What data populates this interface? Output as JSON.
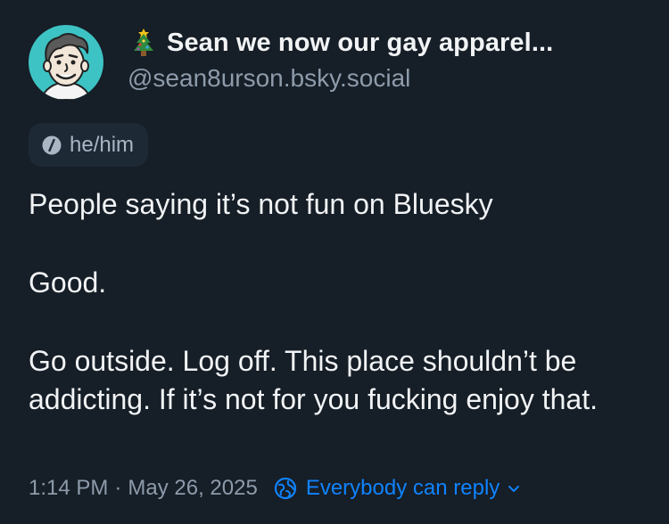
{
  "author": {
    "emoji_icon": "christmas-tree-icon",
    "display_name": "Sean we now our gay apparel...",
    "handle": "@sean8urson.bsky.social",
    "avatar": "cartoon-face-avatar"
  },
  "pronouns": "he/him",
  "post": {
    "paragraphs": [
      "People saying it’s not fun on Bluesky",
      "Good.",
      "Go outside. Log off. This place shouldn’t be addicting. If it’s not for you fucking enjoy that."
    ],
    "time": "1:14 PM",
    "separator": "·",
    "date": "May 26, 2025",
    "reply_setting": "Everybody can reply"
  },
  "colors": {
    "background": "#161e27",
    "text": "#f1f3f5",
    "muted": "#8d9bab",
    "accent": "#1083fe",
    "avatar_bg": "#3ec3c4"
  }
}
